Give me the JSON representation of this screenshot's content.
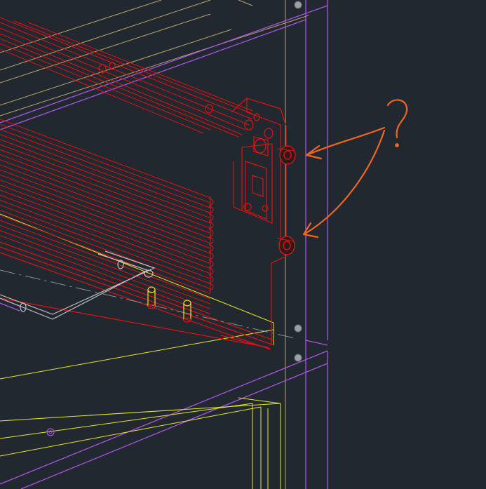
{
  "viewport": {
    "background": "#212830"
  },
  "colors": {
    "drawer_side": "#e31010",
    "cabinet_panel": "#a855e0",
    "drawer_box": "#e8e820",
    "tan_line": "#b9a56a",
    "rod": "#c0c0c0",
    "annotation": "#f2651e",
    "centerline": "#8a8f96",
    "bolt_fill": "#9aa0a6"
  },
  "annotation": {
    "symbol": "?",
    "description_icon": "question-mark-markup",
    "arrow_count": 2
  },
  "bolts": {
    "count": 3
  },
  "yellow_pins": {
    "count": 2
  }
}
